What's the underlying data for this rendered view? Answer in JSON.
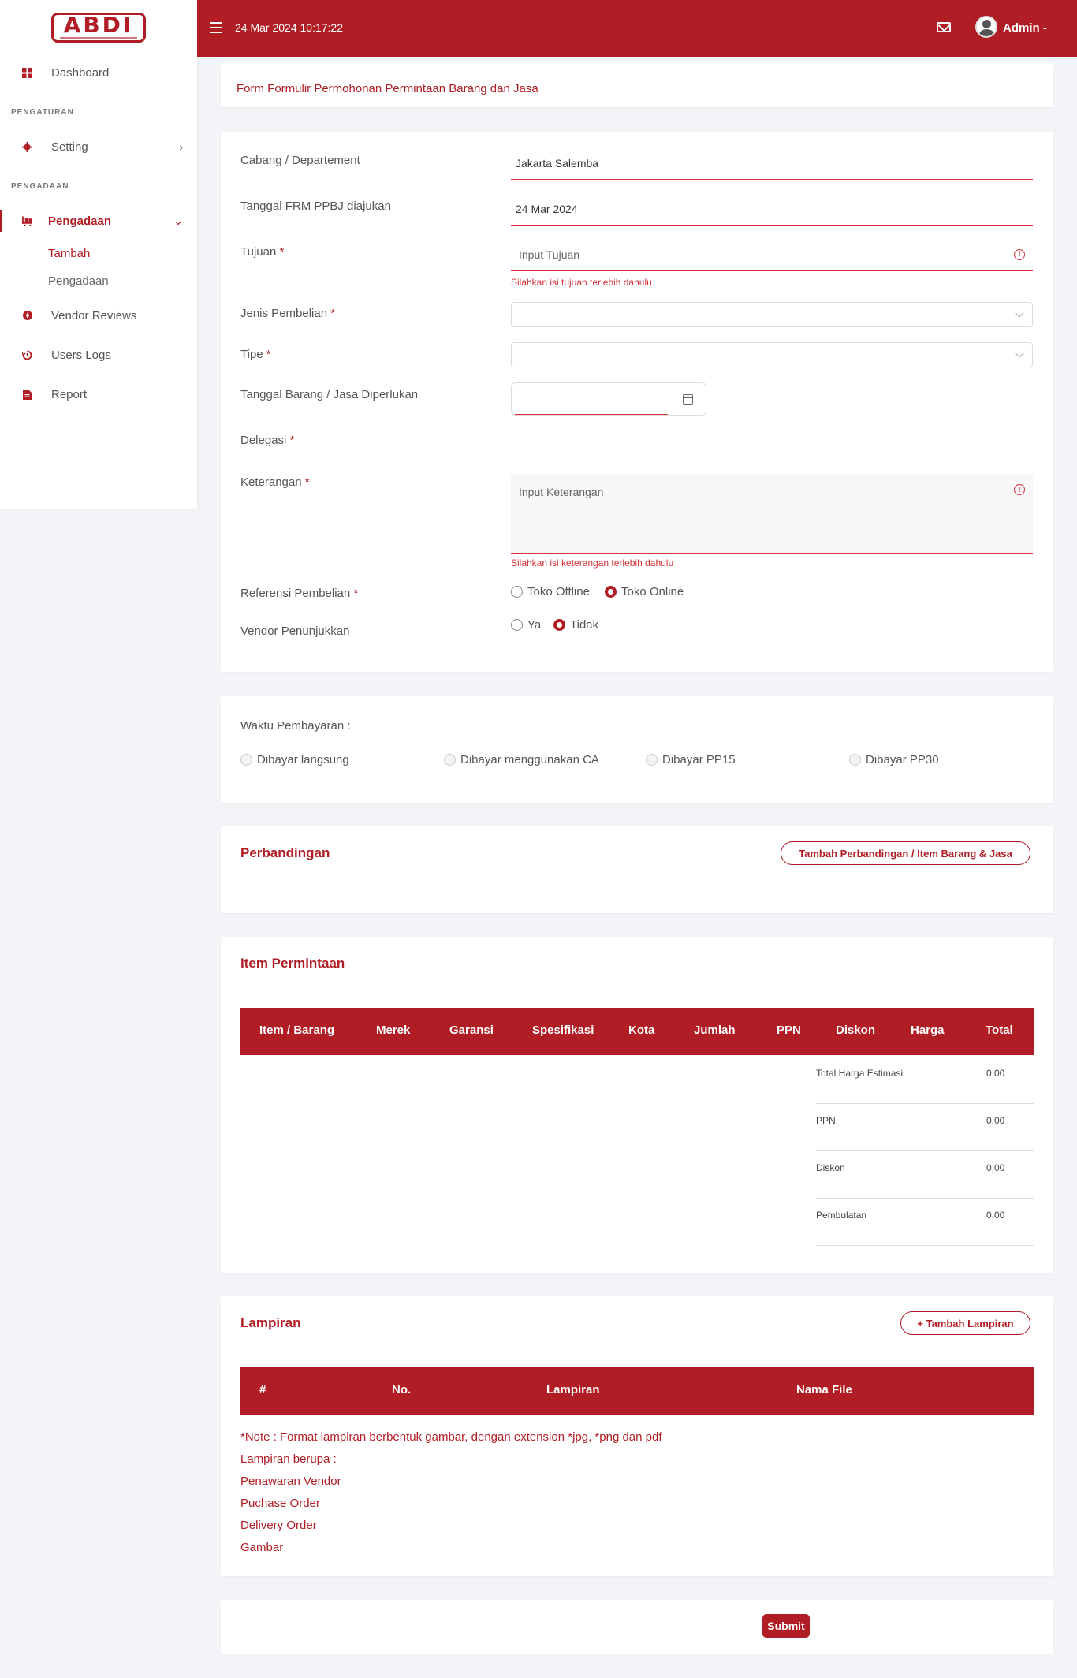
{
  "app": {
    "logo_text": "ABDI"
  },
  "topbar": {
    "datetime": "24 Mar 2024 10:17:22",
    "user": "Admin -"
  },
  "sidebar": {
    "dashboard": "Dashboard",
    "section_pengaturan": "PENGATURAN",
    "setting": "Setting",
    "section_pengadaan": "PENGADAAN",
    "pengadaan": "Pengadaan",
    "sub_tambah": "Tambah",
    "sub_pengadaan": "Pengadaan",
    "vendor_reviews": "Vendor Reviews",
    "users_logs": "Users Logs",
    "report": "Report"
  },
  "page": {
    "title": "Form Formulir Permohonan Permintaan Barang dan Jasa"
  },
  "form": {
    "cabang_label": "Cabang / Departement",
    "cabang_value": "Jakarta Salemba",
    "tanggal_label": "Tanggal FRM PPBJ diajukan",
    "tanggal_value": "24 Mar 2024",
    "tujuan_label": "Tujuan",
    "tujuan_placeholder": "Input Tujuan",
    "tujuan_error": "Silahkan isi tujuan terlebih dahulu",
    "jenis_label": "Jenis Pembelian",
    "tipe_label": "Tipe",
    "tgl_barang_label": "Tanggal Barang / Jasa Diperlukan",
    "delegasi_label": "Delegasi",
    "keterangan_label": "Keterangan",
    "keterangan_placeholder": "Input Keterangan",
    "keterangan_error": "Silahkan isi keterangan terlebih dahulu",
    "referensi_label": "Referensi Pembelian",
    "referensi_opt1": "Toko Offline",
    "referensi_opt2": "Toko Online",
    "vendor_label": "Vendor Penunjukkan",
    "vendor_opt1": "Ya",
    "vendor_opt2": "Tidak",
    "required_mark": "*"
  },
  "waktu": {
    "label": "Waktu Pembayaran :",
    "opt1": "Dibayar langsung",
    "opt2": "Dibayar menggunakan CA",
    "opt3": "Dibayar PP15",
    "opt4": "Dibayar PP30"
  },
  "perbandingan": {
    "title": "Perbandingan",
    "button": "Tambah Perbandingan / Item Barang & Jasa"
  },
  "item": {
    "title": "Item Permintaan",
    "columns": [
      "Item / Barang",
      "Merek",
      "Garansi",
      "Spesifikasi",
      "Kota",
      "Jumlah",
      "PPN",
      "Diskon",
      "Harga",
      "Total"
    ],
    "summary": [
      {
        "label": "Total Harga Estimasi",
        "value": "0,00"
      },
      {
        "label": "PPN",
        "value": "0,00"
      },
      {
        "label": "Diskon",
        "value": "0,00"
      },
      {
        "label": "Pembulatan",
        "value": "0,00"
      }
    ]
  },
  "lampiran": {
    "title": "Lampiran",
    "button": "+ Tambah Lampiran",
    "columns": [
      "#",
      "No.",
      "Lampiran",
      "Nama File"
    ],
    "notes": [
      "*Note : Format lampiran berbentuk gambar, dengan extension *jpg, *png dan pdf",
      "Lampiran berupa :",
      "Penawaran Vendor",
      "Puchase Order",
      "Delivery Order",
      "Gambar"
    ]
  },
  "actions": {
    "submit": "Submit"
  },
  "colors": {
    "primary": "#b01d24",
    "background": "#f3f4f7",
    "error": "#d6323a"
  }
}
